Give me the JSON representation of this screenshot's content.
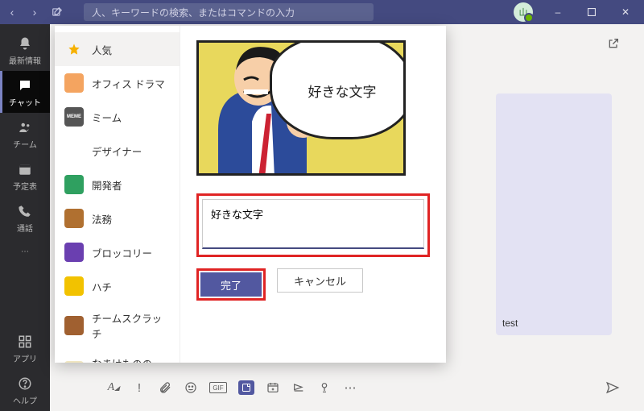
{
  "titlebar": {
    "search_placeholder": "人、キーワードの検索、またはコマンドの入力",
    "avatar_initial": "山"
  },
  "rail": {
    "activity": "最新情報",
    "chat": "チャット",
    "teams": "チーム",
    "calendar": "予定表",
    "calls": "通話",
    "apps": "アプリ",
    "help": "ヘルプ"
  },
  "chat": {
    "message": "test"
  },
  "picker": {
    "categories": [
      {
        "label": "人気",
        "selected": true,
        "bg": "#ffd23f"
      },
      {
        "label": "オフィス ドラマ",
        "bg": "#f4a460"
      },
      {
        "label": "ミーム",
        "bg": "#555"
      },
      {
        "label": "デザイナー",
        "bg": "#fff"
      },
      {
        "label": "開発者",
        "bg": "#2fa060"
      },
      {
        "label": "法務",
        "bg": "#b07030"
      },
      {
        "label": "ブロッコリー",
        "bg": "#6a3fb0"
      },
      {
        "label": "ハチ",
        "bg": "#f2c200"
      },
      {
        "label": "チームスクラッチ",
        "bg": "#a06030"
      },
      {
        "label": "なまけもののバ...",
        "bg": "#f0e6c0"
      }
    ],
    "speech_text": "好きな文字",
    "caption_value": "好きな文字",
    "done_label": "完了",
    "cancel_label": "キャンセル"
  }
}
